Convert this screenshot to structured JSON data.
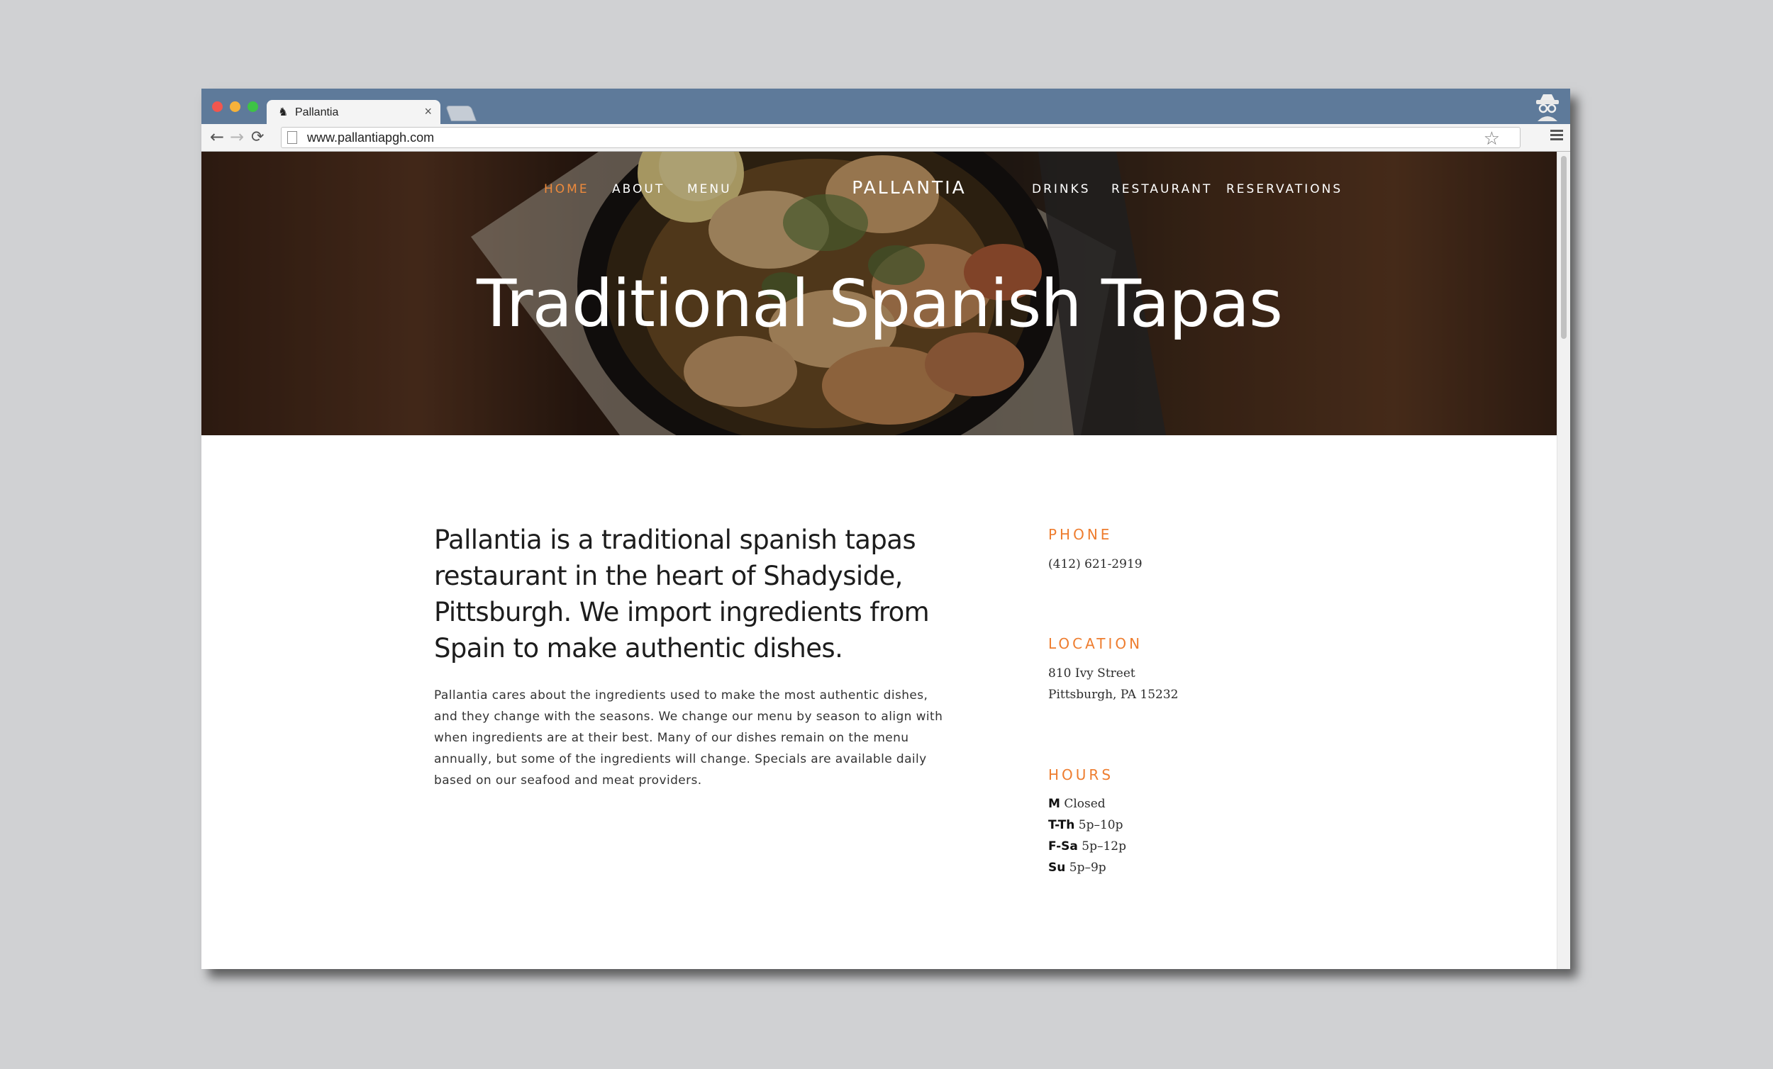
{
  "browser": {
    "tab_title": "Pallantia",
    "tab_close": "×",
    "url": "www.pallantiapgh.com",
    "back": "←",
    "forward": "→",
    "reload": "⟳",
    "star": "☆",
    "favicon": "♞"
  },
  "site": {
    "nav_left": [
      "HOME",
      "ABOUT",
      "MENU"
    ],
    "brand": "PALLANTIA",
    "nav_right": [
      "DRINKS",
      "RESTAURANT",
      "RESERVATIONS"
    ],
    "active_nav": "HOME",
    "accent_color": "#ee7d2f"
  },
  "hero": {
    "title": "Traditional Spanish Tapas"
  },
  "intro": {
    "lead": "Pallantia is a traditional spanish tapas restaurant in the heart of Shadyside, Pittsburgh. We import ingredients from Spain to make authentic dishes.",
    "body": "Pallantia cares about the ingredients used to make the most authentic dishes, and they change with the seasons. We change our menu by season to align with when ingredients are at their best. Many of our dishes remain on the menu annually, but some of the ingredients will change. Specials are available daily based on our seafood and meat providers."
  },
  "contact": {
    "phone_title": "PHONE",
    "phone": "(412) 621-2919",
    "location_title": "LOCATION",
    "address_line1": "810 Ivy Street",
    "address_line2": "Pittsburgh, PA 15232",
    "hours_title": "HOURS",
    "hours": [
      {
        "day": "M",
        "time": "Closed"
      },
      {
        "day": "T-Th",
        "time": "5p–10p"
      },
      {
        "day": "F-Sa",
        "time": "5p–12p"
      },
      {
        "day": "Su",
        "time": "5p–9p"
      }
    ]
  }
}
